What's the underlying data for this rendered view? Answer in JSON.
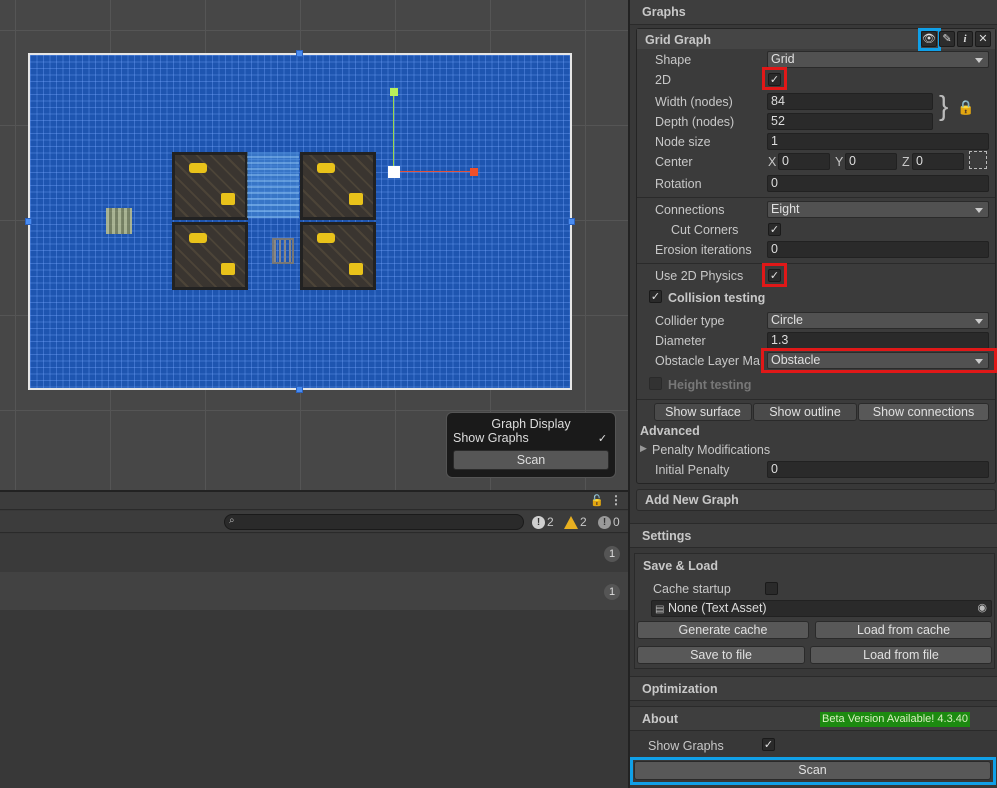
{
  "scene": {
    "graph_display": {
      "title": "Graph Display",
      "show_graphs_label": "Show Graphs",
      "show_graphs_checked": true,
      "scan_label": "Scan"
    }
  },
  "console": {
    "info_count": "2",
    "warn_count": "2",
    "error_count": "0",
    "rows": [
      {
        "count": "1"
      },
      {
        "count": "1"
      }
    ]
  },
  "inspector": {
    "graphs_header": "Graphs",
    "grid_graph": {
      "title": "Grid Graph",
      "shape_label": "Shape",
      "shape_value": "Grid",
      "twod_label": "2D",
      "twod_checked": true,
      "width_label": "Width (nodes)",
      "width_value": "84",
      "depth_label": "Depth (nodes)",
      "depth_value": "52",
      "node_size_label": "Node size",
      "node_size_value": "1",
      "center_label": "Center",
      "center_x_label": "X",
      "center_x": "0",
      "center_y_label": "Y",
      "center_y": "0",
      "center_z_label": "Z",
      "center_z": "0",
      "rotation_label": "Rotation",
      "rotation_value": "0",
      "connections_label": "Connections",
      "connections_value": "Eight",
      "cut_corners_label": "Cut Corners",
      "cut_corners_checked": true,
      "erosion_label": "Erosion iterations",
      "erosion_value": "0",
      "use_2d_physics_label": "Use 2D Physics",
      "use_2d_physics_checked": true,
      "collision_testing_label": "Collision testing",
      "collision_testing_checked": true,
      "collider_type_label": "Collider type",
      "collider_type_value": "Circle",
      "diameter_label": "Diameter",
      "diameter_value": "1.3",
      "obstacle_layer_label": "Obstacle Layer Ma",
      "obstacle_layer_value": "Obstacle",
      "height_testing_label": "Height testing",
      "height_testing_checked": false,
      "show_surface": "Show surface",
      "show_outline": "Show outline",
      "show_connections": "Show connections",
      "advanced_label": "Advanced",
      "penalty_mods_label": "Penalty Modifications",
      "initial_penalty_label": "Initial Penalty",
      "initial_penalty_value": "0"
    },
    "add_new_graph": "Add New Graph",
    "settings_header": "Settings",
    "save_load": {
      "header": "Save & Load",
      "cache_startup_label": "Cache startup",
      "cache_startup_checked": false,
      "asset_value": "None (Text Asset)",
      "generate_cache": "Generate cache",
      "load_from_cache": "Load from cache",
      "save_to_file": "Save to file",
      "load_from_file": "Load from file"
    },
    "optimization_header": "Optimization",
    "about_header": "About",
    "beta_badge": "Beta Version Available! 4.3.40",
    "show_graphs_label": "Show Graphs",
    "show_graphs_checked": true,
    "scan_label": "Scan"
  }
}
